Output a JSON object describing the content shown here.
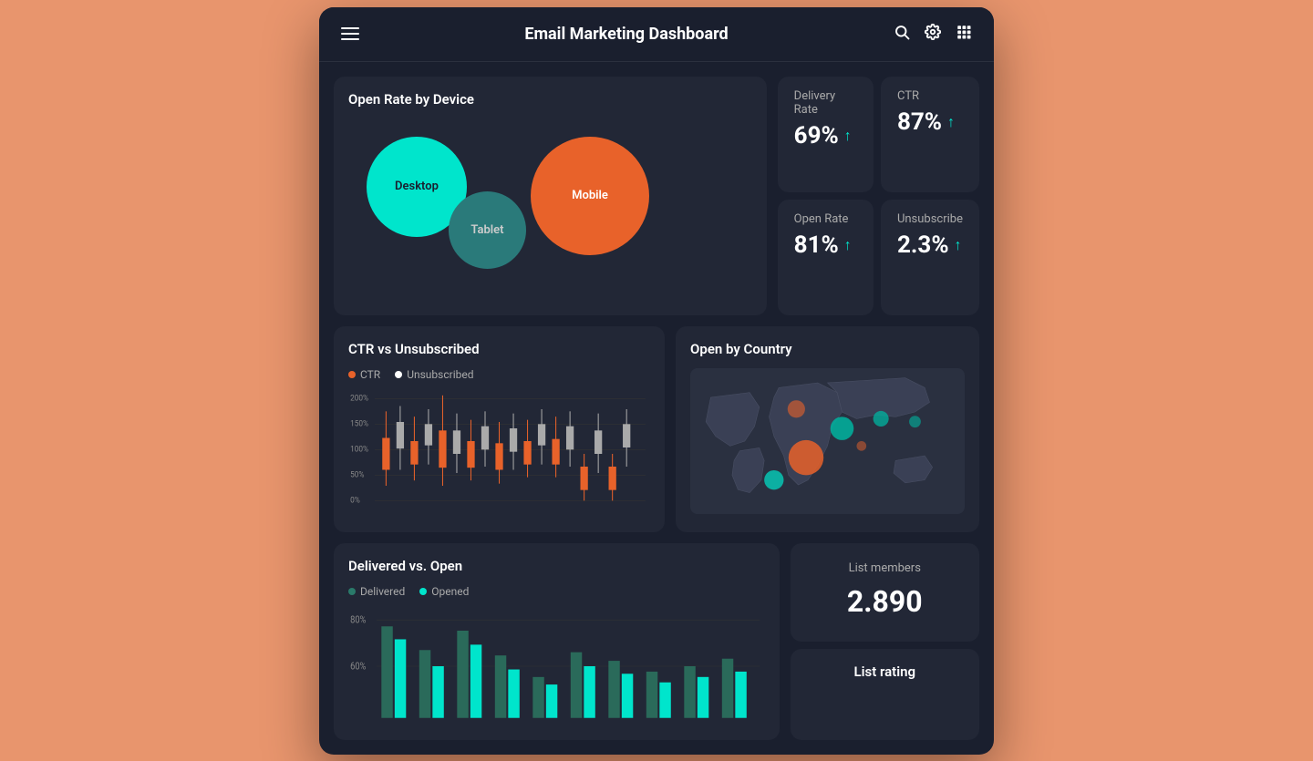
{
  "header": {
    "title": "Email Marketing Dashboard",
    "menu_icon": "☰",
    "search_icon": "🔍",
    "settings_icon": "⚙",
    "grid_icon": "⋮⋮⋮"
  },
  "open_rate_card": {
    "title": "Open Rate by Device",
    "bubbles": [
      {
        "label": "Desktop",
        "color": "#00e5cc",
        "size": 110
      },
      {
        "label": "Tablet",
        "color": "#2a7a7a",
        "size": 85
      },
      {
        "label": "Mobile",
        "color": "#e8622a",
        "size": 130
      }
    ]
  },
  "stats": {
    "delivery_rate": {
      "label": "Delivery Rate",
      "value": "69%",
      "trend": "↑"
    },
    "ctr": {
      "label": "CTR",
      "value": "87%",
      "trend": "↑"
    },
    "open_rate": {
      "label": "Open Rate",
      "value": "81%",
      "trend": "↑"
    },
    "unsubscribe": {
      "label": "Unsubscribe",
      "value": "2.3%",
      "trend": "↑"
    }
  },
  "ctr_chart": {
    "title": "CTR vs Unsubscribed",
    "legend": [
      {
        "label": "CTR",
        "color": "#e8622a"
      },
      {
        "label": "Unsubscribed",
        "color": "#ffffff"
      }
    ],
    "y_labels": [
      "200%",
      "150%",
      "100%",
      "50%",
      "0%"
    ]
  },
  "country_card": {
    "title": "Open by Country"
  },
  "delivered_card": {
    "title": "Delivered vs. Open",
    "legend": [
      {
        "label": "Delivered",
        "color": "#2a7a6a"
      },
      {
        "label": "Opened",
        "color": "#00e5cc"
      }
    ],
    "y_labels": [
      "80%",
      "60%"
    ]
  },
  "list_members": {
    "label": "List members",
    "value": "2.890"
  },
  "list_rating": {
    "label": "List rating"
  }
}
